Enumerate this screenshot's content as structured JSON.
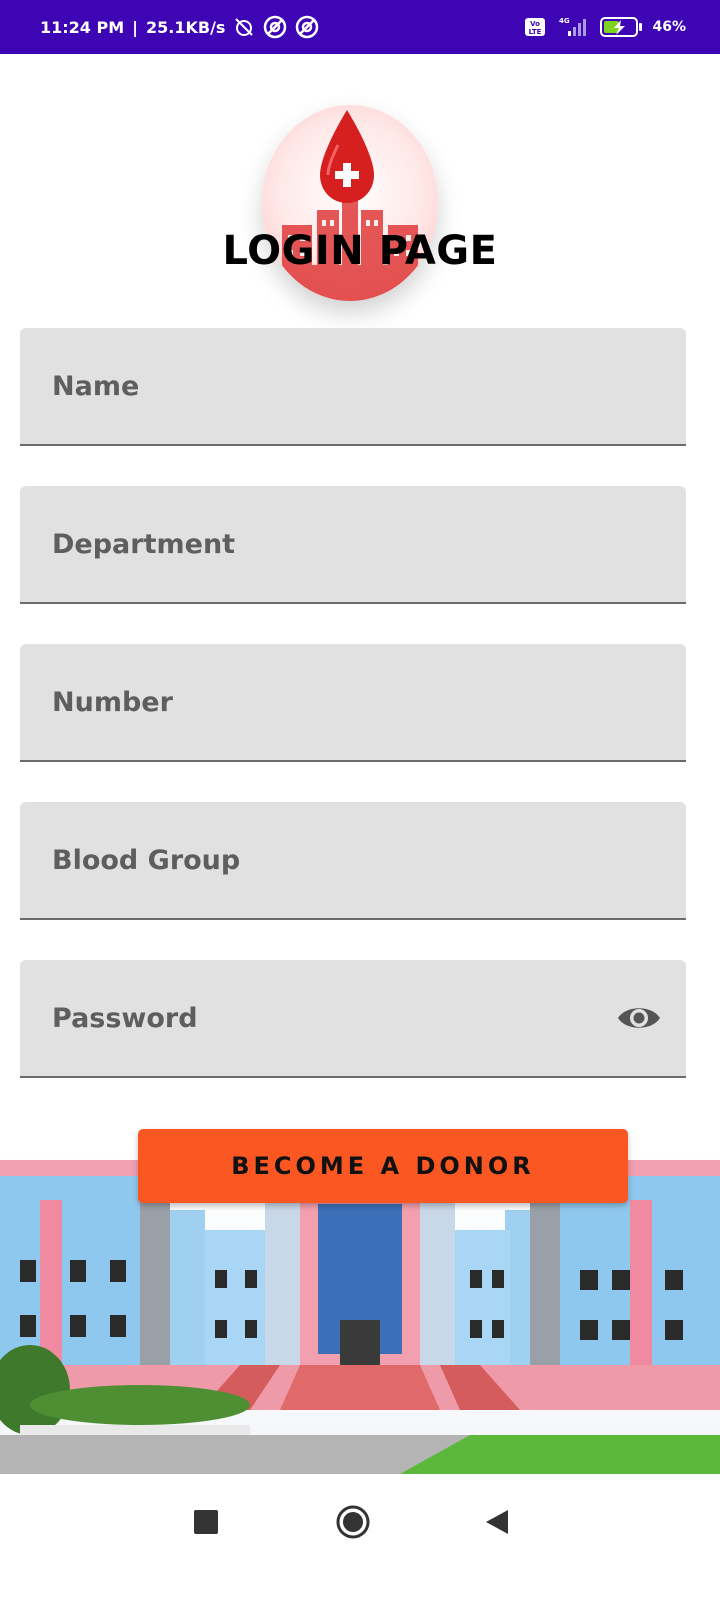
{
  "status_bar": {
    "time": "11:24 PM",
    "separator": "|",
    "speed": "25.1KB/s",
    "network_label": "4G",
    "volte_label": "Vo LTE",
    "battery": "46%"
  },
  "header": {
    "title": "LOGIN PAGE"
  },
  "form": {
    "name_placeholder": "Name",
    "department_placeholder": "Department",
    "number_placeholder": "Number",
    "blood_group_placeholder": "Blood Group",
    "password_placeholder": "Password"
  },
  "actions": {
    "donor_button_label": "BECOME A DONOR"
  },
  "colors": {
    "status_bar": "#3d05b3",
    "field_bg": "#e1e1e1",
    "button_bg": "#fa5722",
    "logo_red": "#d61f1f"
  },
  "icons": {
    "password_toggle": "eye-icon",
    "nav_recents": "square-icon",
    "nav_home": "circle-icon",
    "nav_back": "triangle-back-icon"
  }
}
